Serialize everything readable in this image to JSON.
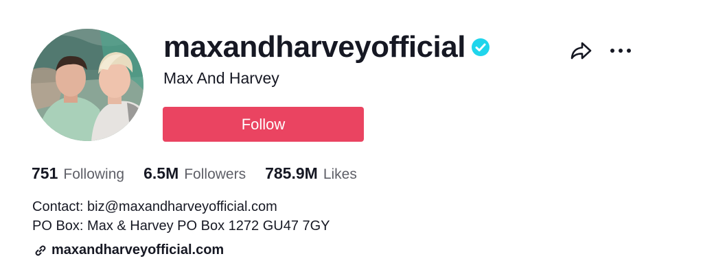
{
  "profile": {
    "username": "maxandharveyofficial",
    "display_name": "Max And Harvey",
    "verified": true,
    "avatar_alt": "profile photo"
  },
  "actions": {
    "follow_label": "Follow",
    "share_icon": "share-icon",
    "more_icon": "more-icon"
  },
  "stats": [
    {
      "number": "751",
      "label": "Following"
    },
    {
      "number": "6.5M",
      "label": "Followers"
    },
    {
      "number": "785.9M",
      "label": "Likes"
    }
  ],
  "bio": {
    "lines": [
      "Contact: biz@maxandharveyofficial.com",
      "PO Box: Max & Harvey PO Box 1272 GU47 7GY"
    ]
  },
  "link": {
    "icon": "link-icon",
    "text": "maxandharveyofficial.com"
  },
  "colors": {
    "follow_button": "#ea4461",
    "verified_badge": "#20d5ec",
    "secondary_text": "#5e5f67"
  }
}
